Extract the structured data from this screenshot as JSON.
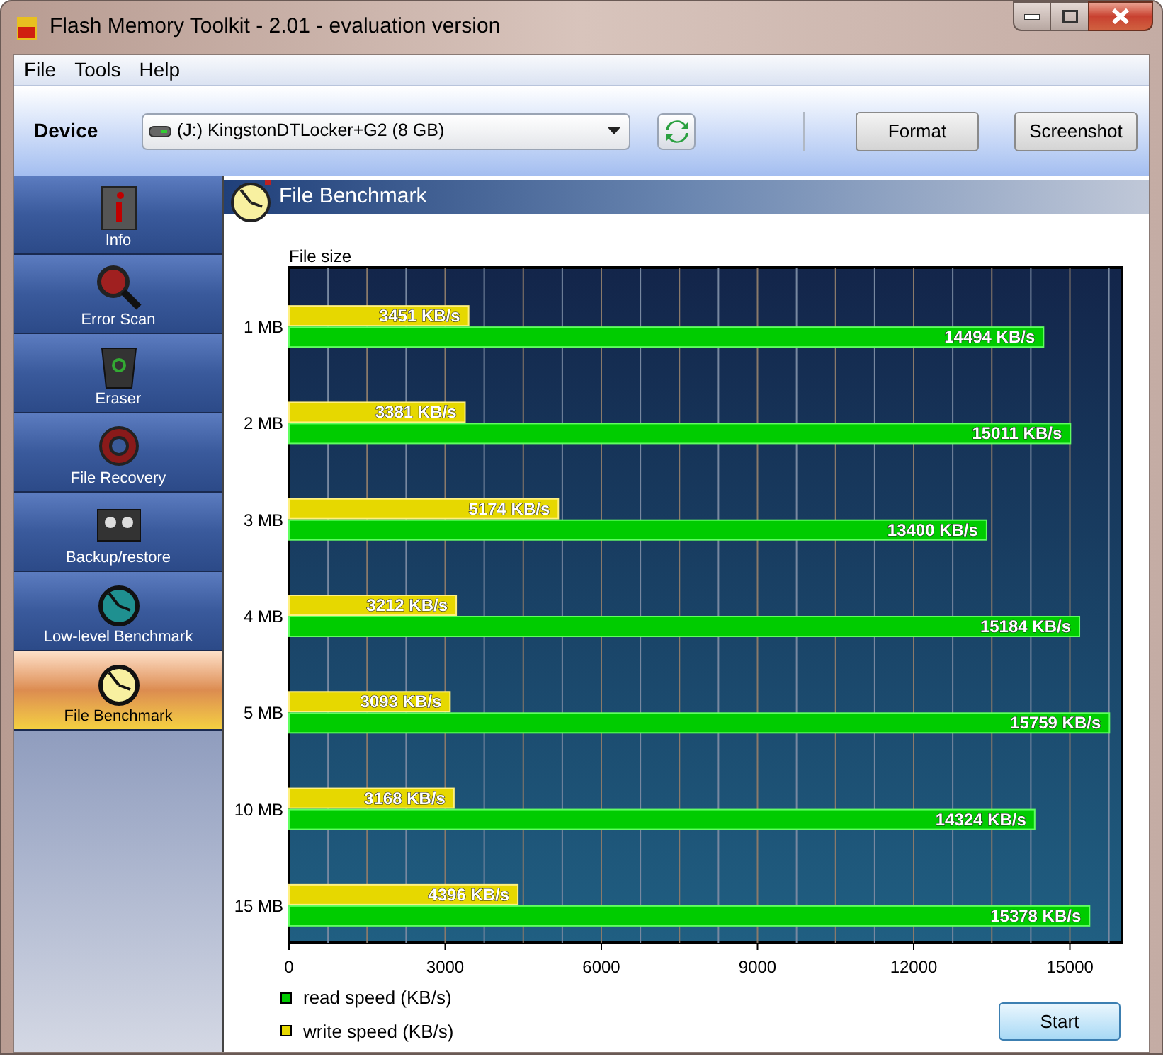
{
  "window": {
    "title": "Flash Memory Toolkit - 2.01 - evaluation version"
  },
  "menu": [
    "File",
    "Tools",
    "Help"
  ],
  "toolbar": {
    "device_label": "Device",
    "device_value": "(J:) KingstonDTLocker+G2 (8 GB)",
    "buttons": [
      "Format",
      "Screenshot"
    ]
  },
  "sidebar": {
    "items": [
      {
        "label": "Info",
        "kind": "info",
        "selected": false
      },
      {
        "label": "Error Scan",
        "kind": "scan",
        "selected": false
      },
      {
        "label": "Eraser",
        "kind": "eraser",
        "selected": false
      },
      {
        "label": "File Recovery",
        "kind": "recovery",
        "selected": false
      },
      {
        "label": "Backup/restore",
        "kind": "backup",
        "selected": false
      },
      {
        "label": "Low-level Benchmark",
        "kind": "lowbench",
        "selected": false
      },
      {
        "label": "File Benchmark",
        "kind": "filebench",
        "selected": true
      }
    ]
  },
  "panel": {
    "title": "File Benchmark",
    "chart_data": {
      "type": "bar",
      "orientation": "horizontal",
      "ylabel": "File size",
      "categories": [
        "1 MB",
        "2 MB",
        "3 MB",
        "4 MB",
        "5 MB",
        "10 MB",
        "15 MB"
      ],
      "series": [
        {
          "name": "read speed (KB/s)",
          "color": "#00cc00",
          "values": [
            14494,
            15011,
            13400,
            15184,
            15759,
            14324,
            15378
          ],
          "value_labels": [
            "14494 KB/s",
            "15011 KB/s",
            "13400 KB/s",
            "15184 KB/s",
            "15759 KB/s",
            "14324 KB/s",
            "15378 KB/s"
          ]
        },
        {
          "name": "write speed (KB/s)",
          "color": "#e6d800",
          "values": [
            3451,
            3381,
            5174,
            3212,
            3093,
            3168,
            4396
          ],
          "value_labels": [
            "3451 KB/s",
            "3381 KB/s",
            "5174 KB/s",
            "3212 KB/s",
            "3093 KB/s",
            "3168 KB/s",
            "4396 KB/s"
          ]
        }
      ],
      "grid": true,
      "xlim": [
        0,
        16000
      ],
      "xticks": [
        0,
        3000,
        6000,
        9000,
        12000,
        15000
      ]
    },
    "start_button": "Start"
  }
}
